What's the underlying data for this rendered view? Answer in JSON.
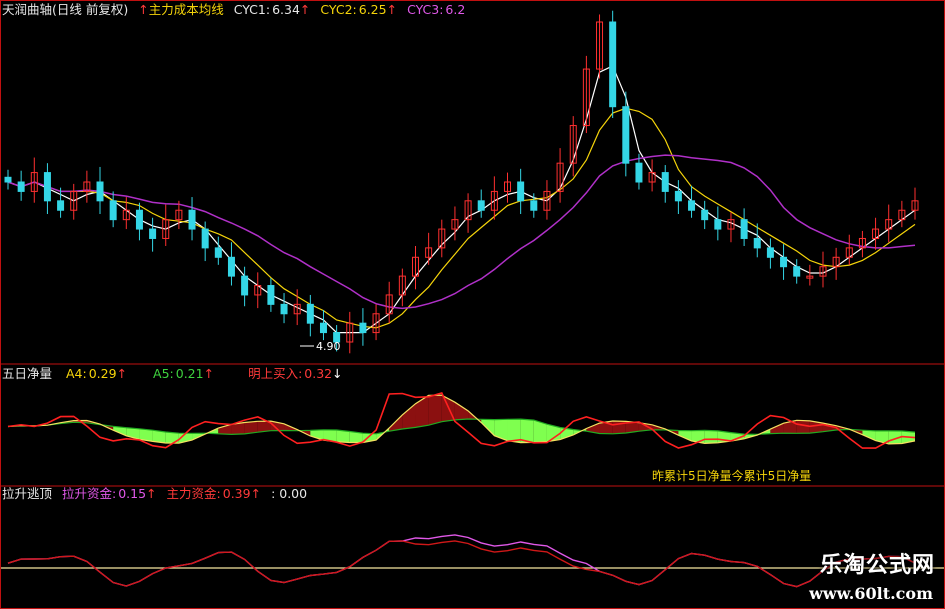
{
  "panel1": {
    "title": "天润曲轴",
    "period": "(日线 前复权)",
    "indicator": "主力成本均线",
    "cyc1_label": "CYC1:",
    "cyc1_value": "6.34",
    "cyc2_label": "CYC2:",
    "cyc2_value": "6.25",
    "cyc3_label": "CYC3:",
    "cyc3_value": "6.2",
    "low_label": "4.90"
  },
  "panel2": {
    "title": "五日净量",
    "a4_label": "A4:",
    "a4_value": "0.29",
    "a5_label": "A5:",
    "a5_value": "0.21",
    "buy_label": "明上买入:",
    "buy_value": "0.32",
    "annotation": "昨累计5日净量今累计5日净量"
  },
  "panel3": {
    "title": "拉升逃顶",
    "lift_label": "拉升资金:",
    "lift_value": "0.15",
    "main_label": "主力资金:",
    "main_value": "0.39",
    "extra_value": ": 0.00"
  },
  "watermark": {
    "line1": "乐淘公式网",
    "line2": "www.60lt.com"
  },
  "colors": {
    "up": "#ff3030",
    "down": "#34d6e6",
    "cyc1": "#ffffff",
    "cyc2": "#f5d40a",
    "cyc3": "#b030c8",
    "net_fill": "#7fff4f",
    "net_pos_fill": "#8b1010",
    "a4_line": "#ff2020",
    "a5_line": "#f5e060",
    "a6_line": "#22aa22",
    "lift_line": "#e058e8",
    "main_line": "#d01818",
    "base_line": "#f5e6a0",
    "divider": "#c01010"
  },
  "chart_data": [
    {
      "type": "candlestick",
      "title": "天润曲轴 (日线 前复权)",
      "series_names": [
        "CYC1",
        "CYC2",
        "CYC3"
      ],
      "last_values": {
        "CYC1": 6.34,
        "CYC2": 6.25,
        "CYC3": 6.2
      },
      "annotations": [
        {
          "text": "4.90",
          "meaning": "period low"
        }
      ],
      "closes": [
        6.6,
        6.5,
        6.7,
        6.4,
        6.3,
        6.5,
        6.6,
        6.4,
        6.2,
        6.3,
        6.1,
        6.0,
        6.2,
        6.3,
        6.1,
        5.9,
        5.8,
        5.6,
        5.4,
        5.5,
        5.3,
        5.2,
        5.3,
        5.1,
        5.0,
        4.9,
        5.1,
        5.0,
        5.2,
        5.4,
        5.6,
        5.8,
        5.9,
        6.1,
        6.2,
        6.4,
        6.3,
        6.5,
        6.6,
        6.4,
        6.3,
        6.5,
        6.8,
        7.2,
        7.8,
        8.3,
        7.4,
        6.8,
        6.6,
        6.7,
        6.5,
        6.4,
        6.3,
        6.2,
        6.1,
        6.2,
        6.0,
        5.9,
        5.8,
        5.7,
        5.6,
        5.6,
        5.7,
        5.8,
        5.9,
        6.0,
        6.1,
        6.2,
        6.3,
        6.4
      ]
    },
    {
      "type": "line",
      "title": "五日净量",
      "series": [
        {
          "name": "A4",
          "last": 0.29
        },
        {
          "name": "A5",
          "last": 0.21
        },
        {
          "name": "明上买入",
          "last": 0.32
        }
      ]
    },
    {
      "type": "line",
      "title": "拉升逃顶",
      "series": [
        {
          "name": "拉升资金",
          "last": 0.15
        },
        {
          "name": "主力资金",
          "last": 0.39
        }
      ]
    }
  ]
}
